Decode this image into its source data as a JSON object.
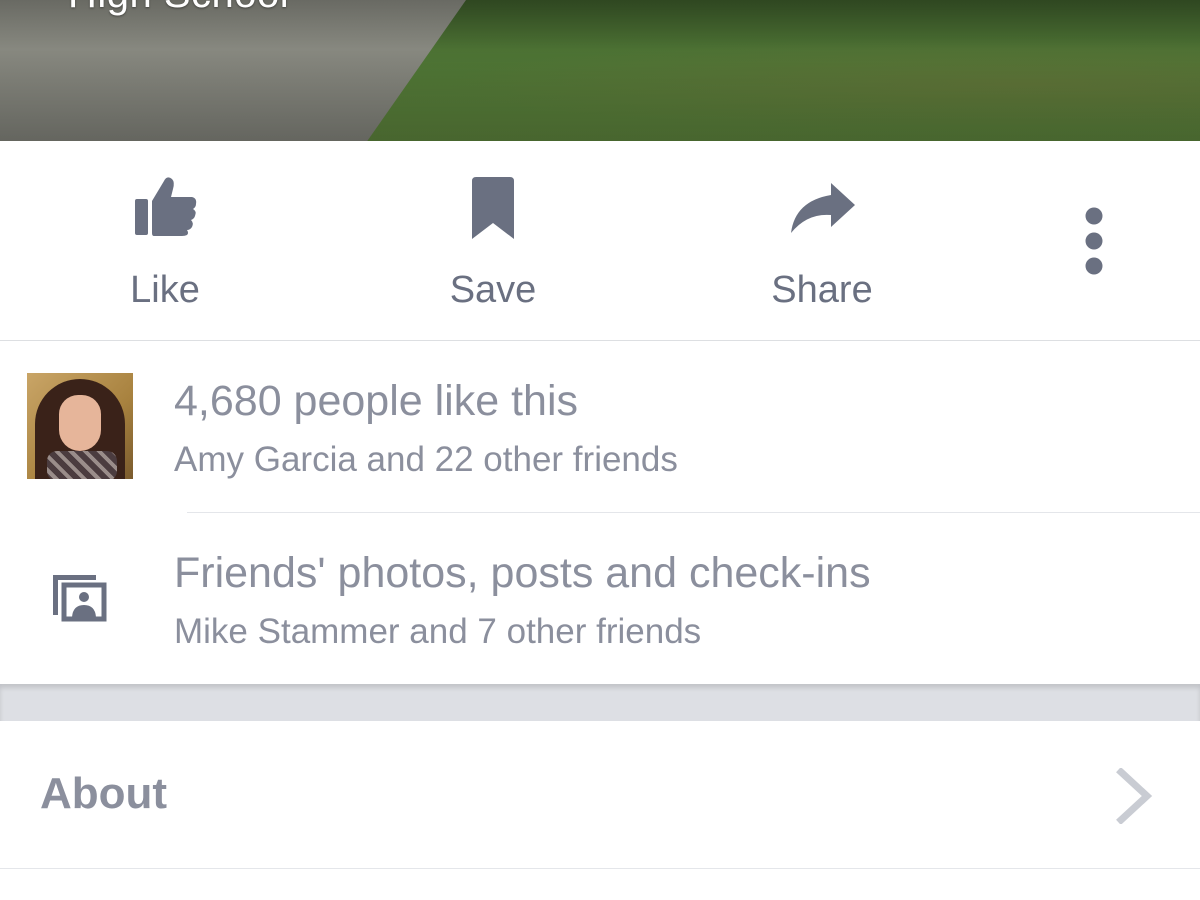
{
  "cover": {
    "title": "High School"
  },
  "actions": [
    {
      "label": "Like",
      "icon": "thumbs-up-icon"
    },
    {
      "label": "Save",
      "icon": "bookmark-icon"
    },
    {
      "label": "Share",
      "icon": "share-arrow-icon"
    },
    {
      "label": "",
      "icon": "more-vertical-icon"
    }
  ],
  "likes": {
    "title": "4,680 people like this",
    "subtitle": "Amy Garcia and 22 other friends"
  },
  "friends_content": {
    "title": "Friends' photos, posts and check-ins",
    "subtitle": "Mike Stammer and 7 other friends",
    "icon": "photo-stack-icon"
  },
  "about": {
    "label": "About",
    "icon": "chevron-right-icon"
  },
  "colors": {
    "icon": "#6a7081",
    "text_secondary": "#8b8f9d",
    "divider": "#dddfe2",
    "band": "#dddfe4"
  }
}
